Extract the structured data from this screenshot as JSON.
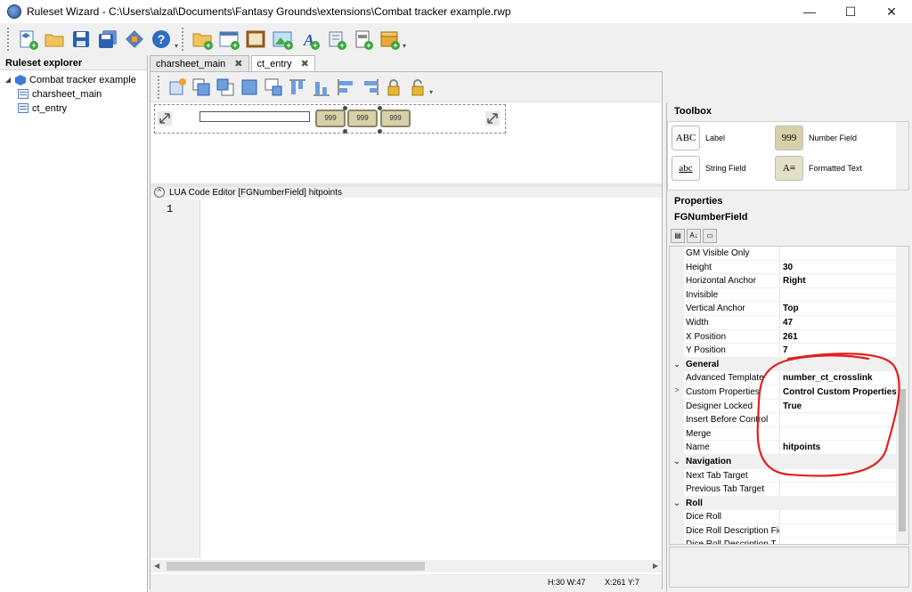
{
  "window": {
    "title": "Ruleset Wizard - C:\\Users\\alzal\\Documents\\Fantasy Grounds\\extensions\\Combat tracker example.rwp",
    "minimize": "—",
    "maximize": "☐",
    "close": "✕"
  },
  "explorer": {
    "header": "Ruleset explorer",
    "root": "Combat tracker example",
    "items": [
      "charsheet_main",
      "ct_entry"
    ]
  },
  "tabs": [
    {
      "label": "charsheet_main",
      "close": "✖"
    },
    {
      "label": "ct_entry",
      "close": "✖"
    }
  ],
  "canvas": {
    "numfields": [
      "999",
      "999",
      "999"
    ]
  },
  "lua": {
    "collapse": "^",
    "title": "LUA Code Editor [FGNumberField] hitpoints",
    "line1": "1"
  },
  "status": {
    "size": "H:30  W:47",
    "pos": "X:261  Y:7"
  },
  "toolbox": {
    "header": "Toolbox",
    "tools": [
      {
        "icon": "ABC",
        "label": "Label"
      },
      {
        "icon": "999",
        "label": "Number Field"
      },
      {
        "icon": "abc",
        "label": "String Field"
      },
      {
        "icon": "A≡",
        "label": "Formatted Text"
      }
    ]
  },
  "properties": {
    "header": "Properties",
    "object": "FGNumberField",
    "rows": [
      {
        "type": "prop",
        "name": "GM Visible Only",
        "value": ""
      },
      {
        "type": "prop",
        "name": "Height",
        "value": "30"
      },
      {
        "type": "prop",
        "name": "Horizontal Anchor",
        "value": "Right"
      },
      {
        "type": "prop",
        "name": "Invisible",
        "value": ""
      },
      {
        "type": "prop",
        "name": "Vertical Anchor",
        "value": "Top"
      },
      {
        "type": "prop",
        "name": "Width",
        "value": "47"
      },
      {
        "type": "prop",
        "name": "X Position",
        "value": "261"
      },
      {
        "type": "prop",
        "name": "Y Position",
        "value": "7"
      },
      {
        "type": "cat",
        "name": "General"
      },
      {
        "type": "prop",
        "name": "Advanced Template",
        "value": "number_ct_crosslink"
      },
      {
        "type": "prop",
        "name": "Custom Properties",
        "value": "Control Custom Properties",
        "expander": ">"
      },
      {
        "type": "prop",
        "name": "Designer Locked",
        "value": "True"
      },
      {
        "type": "prop",
        "name": "Insert Before Control",
        "value": ""
      },
      {
        "type": "prop",
        "name": "Merge",
        "value": ""
      },
      {
        "type": "prop",
        "name": "Name",
        "value": "hitpoints"
      },
      {
        "type": "cat",
        "name": "Navigation"
      },
      {
        "type": "prop",
        "name": "Next Tab Target",
        "value": ""
      },
      {
        "type": "prop",
        "name": "Previous Tab Target",
        "value": ""
      },
      {
        "type": "cat",
        "name": "Roll"
      },
      {
        "type": "prop",
        "name": "Dice Roll",
        "value": ""
      },
      {
        "type": "prop",
        "name": "Dice Roll Description Fie",
        "value": ""
      },
      {
        "type": "prop",
        "name": "Dice Roll Description T",
        "value": ""
      }
    ]
  },
  "colors": {
    "annotation": "#e02020",
    "numfield_fill": "#d7d1a9"
  }
}
